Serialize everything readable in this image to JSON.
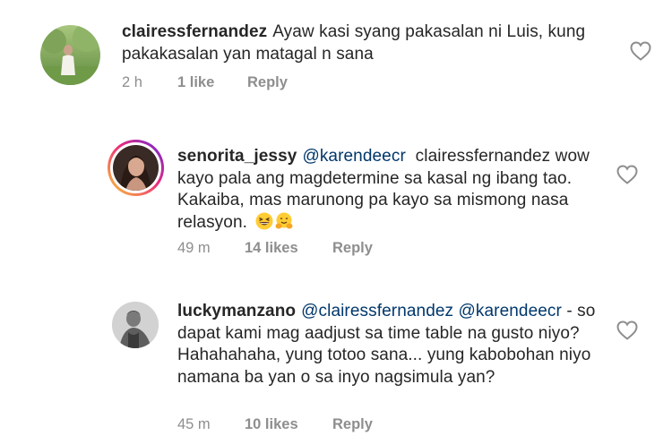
{
  "comments": [
    {
      "username": "clairessfernandez",
      "mention": "",
      "text": "Ayaw kasi syang pakasalan ni Luis, kung pakakasalan yan matagal n sana",
      "time": "2 h",
      "likes": "1 like",
      "reply": "Reply",
      "avatar_icon": "profile-photo-outdoor"
    },
    {
      "username": "senorita_jessy",
      "mention": "@karendeecr",
      "text": "clairessfernandez wow kayo pala ang magdetermine sa kasal ng ibang tao. Kakaiba, mas marunong pa kayo sa mismong nasa relasyon.",
      "emojis": [
        "grinning-squinting-face",
        "hugging-face"
      ],
      "time": "49 m",
      "likes": "14 likes",
      "reply": "Reply",
      "avatar_icon": "profile-photo-story-ring"
    },
    {
      "username": "luckymanzano",
      "mention": "@clairessfernandez @karendeecr",
      "text": "- so dapat kami mag aadjust sa time table na gusto niyo? Hahahahaha, yung totoo sana... yung kabobohan niyo namana ba yan o sa inyo nagsimula yan?",
      "time": "45 m",
      "likes": "10 likes",
      "reply": "Reply",
      "avatar_icon": "profile-photo-bw"
    }
  ],
  "colors": {
    "text": "#262626",
    "meta": "#8e8e8e",
    "mention": "#00376b",
    "heart_outline": "#8e8e8e"
  }
}
